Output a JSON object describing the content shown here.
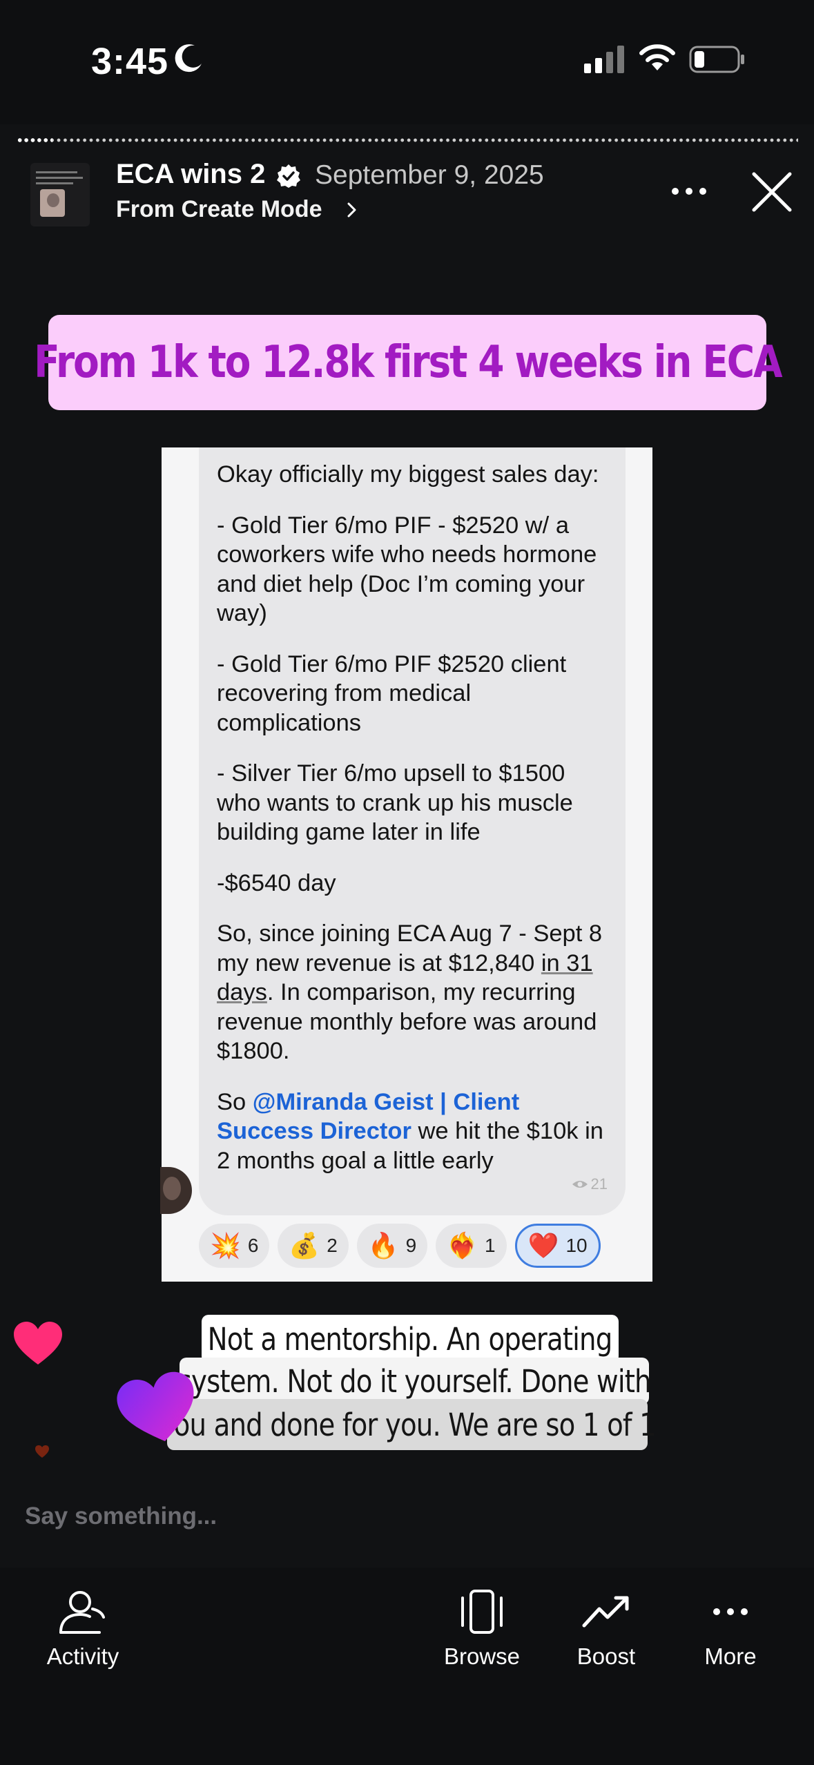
{
  "status_bar": {
    "time": "3:45",
    "icons": [
      "moon-icon",
      "signal-icon",
      "wifi-icon",
      "battery-icon"
    ]
  },
  "story": {
    "title": "ECA wins 2",
    "date": "September 9, 2025",
    "source": "From Create Mode",
    "icons": [
      "verified-icon",
      "chevron-right-icon",
      "more-dots-icon",
      "close-icon"
    ]
  },
  "banner": {
    "text": "From 1k to 12.8k first 4 weeks in ECA"
  },
  "message": {
    "p1": "Okay officially my biggest sales day:",
    "p2": "- Gold Tier 6/mo PIF - $2520 w/ a coworkers wife who needs hormone and diet help (Doc I’m coming your way)",
    "p3": "- Gold Tier 6/mo PIF  $2520 client recovering from medical complications",
    "p4": "- Silver Tier 6/mo upsell to $1500 who wants to crank up his muscle building game later in life",
    "p5": "-$6540 day",
    "p6_a": "So, since joining ECA Aug 7 - Sept 8 my new revenue is at $12,840 ",
    "p6_u": "in 31 days",
    "p6_b": ". In comparison, my recurring revenue monthly before was around $1800.",
    "p7_a": "So ",
    "p7_mention": "@Miranda Geist | Client Success Director",
    "p7_b": "  we hit the $10k in 2 months goal a little early",
    "seen_count": "21"
  },
  "reactions": [
    {
      "emoji": "💥",
      "count": "6"
    },
    {
      "emoji": "💰",
      "count": "2"
    },
    {
      "emoji": "🔥",
      "count": "9"
    },
    {
      "emoji": "❤️‍🔥",
      "count": "1"
    },
    {
      "emoji": "❤️",
      "count": "10"
    }
  ],
  "caption": {
    "line1": "Not a mentorship. An operating",
    "line2": "system. Not do it yourself. Done with",
    "line3": "you and done for you. We are so 1 of 1"
  },
  "comment": {
    "placeholder": "Say something..."
  },
  "bottom_nav": {
    "activity": "Activity",
    "browse": "Browse",
    "boost": "Boost",
    "more": "More"
  },
  "colors": {
    "background": "#111214",
    "banner_bg": "#fbcdfb",
    "banner_text": "#a21bc2",
    "mention": "#1c63d6",
    "heart_pink": "#ff2d78",
    "heart_purple": "#9b2cf0"
  }
}
